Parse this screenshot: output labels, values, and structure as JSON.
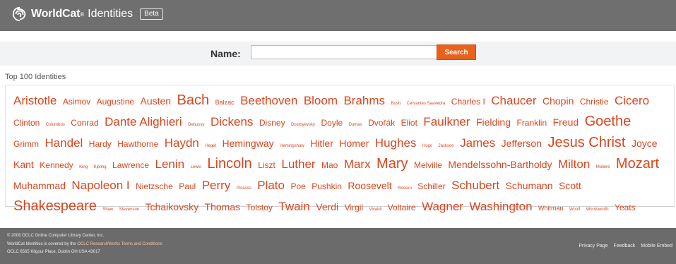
{
  "header": {
    "brand": "WorldCat",
    "reg_mark": "®",
    "product": "Identities",
    "badge": "Beta"
  },
  "search": {
    "label": "Name:",
    "value": "",
    "placeholder": "",
    "button": "Search"
  },
  "cloud": {
    "title": "Top 100 Identities",
    "tags": [
      {
        "t": "Aristotle",
        "s": 5
      },
      {
        "t": "Asimov",
        "s": 3
      },
      {
        "t": "Augustine",
        "s": 3
      },
      {
        "t": "Austen",
        "s": 4
      },
      {
        "t": "Bach",
        "s": 6
      },
      {
        "t": "Balzac",
        "s": 2
      },
      {
        "t": "Beethoven",
        "s": 5
      },
      {
        "t": "Bloom",
        "s": 5
      },
      {
        "t": "Brahms",
        "s": 5
      },
      {
        "t": "Bush",
        "s": 1
      },
      {
        "t": "Cervantes Saavedra",
        "s": 1
      },
      {
        "t": "Charles I",
        "s": 3
      },
      {
        "t": "Chaucer",
        "s": 5
      },
      {
        "t": "Chopin",
        "s": 4
      },
      {
        "t": "Christie",
        "s": 3
      },
      {
        "t": "Cicero",
        "s": 5
      },
      {
        "t": "Clinton",
        "s": 3
      },
      {
        "t": "Columbus",
        "s": 1
      },
      {
        "t": "Conrad",
        "s": 3
      },
      {
        "t": "Dante Alighieri",
        "s": 5
      },
      {
        "t": "Debussy",
        "s": 1
      },
      {
        "t": "Dickens",
        "s": 5
      },
      {
        "t": "Disney",
        "s": 3
      },
      {
        "t": "Dostoyevsky",
        "s": 1
      },
      {
        "t": "Doyle",
        "s": 3
      },
      {
        "t": "Dumas",
        "s": 1
      },
      {
        "t": "Dvořák",
        "s": 3
      },
      {
        "t": "Eliot",
        "s": 3
      },
      {
        "t": "Faulkner",
        "s": 5
      },
      {
        "t": "Fielding",
        "s": 4
      },
      {
        "t": "Franklin",
        "s": 3
      },
      {
        "t": "Freud",
        "s": 4
      },
      {
        "t": "Goethe",
        "s": 6
      },
      {
        "t": "Grimm",
        "s": 3
      },
      {
        "t": "Handel",
        "s": 5
      },
      {
        "t": "Hardy",
        "s": 3
      },
      {
        "t": "Hawthorne",
        "s": 3
      },
      {
        "t": "Haydn",
        "s": 5
      },
      {
        "t": "Hegel",
        "s": 1
      },
      {
        "t": "Hemingway",
        "s": 4
      },
      {
        "t": "Hemingshaw",
        "s": 1
      },
      {
        "t": "Hitler",
        "s": 4
      },
      {
        "t": "Homer",
        "s": 4
      },
      {
        "t": "Hughes",
        "s": 5
      },
      {
        "t": "Hugo",
        "s": 1
      },
      {
        "t": "Jackson",
        "s": 1
      },
      {
        "t": "James",
        "s": 5
      },
      {
        "t": "Jefferson",
        "s": 4
      },
      {
        "t": "Jesus Christ",
        "s": 6
      },
      {
        "t": "Joyce",
        "s": 4
      },
      {
        "t": "Kant",
        "s": 4
      },
      {
        "t": "Kennedy",
        "s": 3
      },
      {
        "t": "King",
        "s": 1
      },
      {
        "t": "Kipling",
        "s": 1
      },
      {
        "t": "Lawrence",
        "s": 3
      },
      {
        "t": "Lenin",
        "s": 5
      },
      {
        "t": "Lewis",
        "s": 1
      },
      {
        "t": "Lincoln",
        "s": 6
      },
      {
        "t": "Liszt",
        "s": 3
      },
      {
        "t": "Luther",
        "s": 5
      },
      {
        "t": "Mao",
        "s": 3
      },
      {
        "t": "Marx",
        "s": 5
      },
      {
        "t": "Mary",
        "s": 6
      },
      {
        "t": "Melville",
        "s": 3
      },
      {
        "t": "Mendelssohn-Bartholdy",
        "s": 4
      },
      {
        "t": "Milton",
        "s": 5
      },
      {
        "t": "Molière",
        "s": 1
      },
      {
        "t": "Mozart",
        "s": 6
      },
      {
        "t": "Muḥammad",
        "s": 4
      },
      {
        "t": "Napoleon I",
        "s": 5
      },
      {
        "t": "Nietzsche",
        "s": 3
      },
      {
        "t": "Paul",
        "s": 3
      },
      {
        "t": "Perry",
        "s": 5
      },
      {
        "t": "Picasso",
        "s": 1
      },
      {
        "t": "Plato",
        "s": 5
      },
      {
        "t": "Poe",
        "s": 3
      },
      {
        "t": "Pushkin",
        "s": 3
      },
      {
        "t": "Roosevelt",
        "s": 4
      },
      {
        "t": "Rossini",
        "s": 1
      },
      {
        "t": "Schiller",
        "s": 3
      },
      {
        "t": "Schubert",
        "s": 5
      },
      {
        "t": "Schumann",
        "s": 4
      },
      {
        "t": "Scott",
        "s": 4
      },
      {
        "t": "Shakespeare",
        "s": 6
      },
      {
        "t": "Shaw",
        "s": 1
      },
      {
        "t": "Stevenson",
        "s": 1
      },
      {
        "t": "Tchaikovsky",
        "s": 4
      },
      {
        "t": "Thomas",
        "s": 4
      },
      {
        "t": "Tolstoy",
        "s": 3
      },
      {
        "t": "Twain",
        "s": 5
      },
      {
        "t": "Verdi",
        "s": 4
      },
      {
        "t": "Virgil",
        "s": 3
      },
      {
        "t": "Vivaldi",
        "s": 1
      },
      {
        "t": "Voltaire",
        "s": 3
      },
      {
        "t": "Wagner",
        "s": 5
      },
      {
        "t": "Washington",
        "s": 5
      },
      {
        "t": "Whitman",
        "s": 2
      },
      {
        "t": "Woolf",
        "s": 1
      },
      {
        "t": "Wordsworth",
        "s": 1
      },
      {
        "t": "Yeats",
        "s": 3
      }
    ]
  },
  "footer": {
    "line1": "© 2008 OCLC Online Computer Library Center, Inc.",
    "line2_a": "WorldCat Identities is covered by the ",
    "line2_link": "OCLC ResearchWorks Terms and Conditions",
    "line3": "OCLC 6565 Kilgour Place, Dublin OH USA 43017",
    "links": [
      "Privacy Page",
      "Feedback",
      "Mobile Embed"
    ]
  },
  "colors": {
    "header_bg": "#6f6f6f",
    "accent": "#e8621e",
    "tag_text": "#d8461e",
    "search_band": "#f1f3f5"
  }
}
